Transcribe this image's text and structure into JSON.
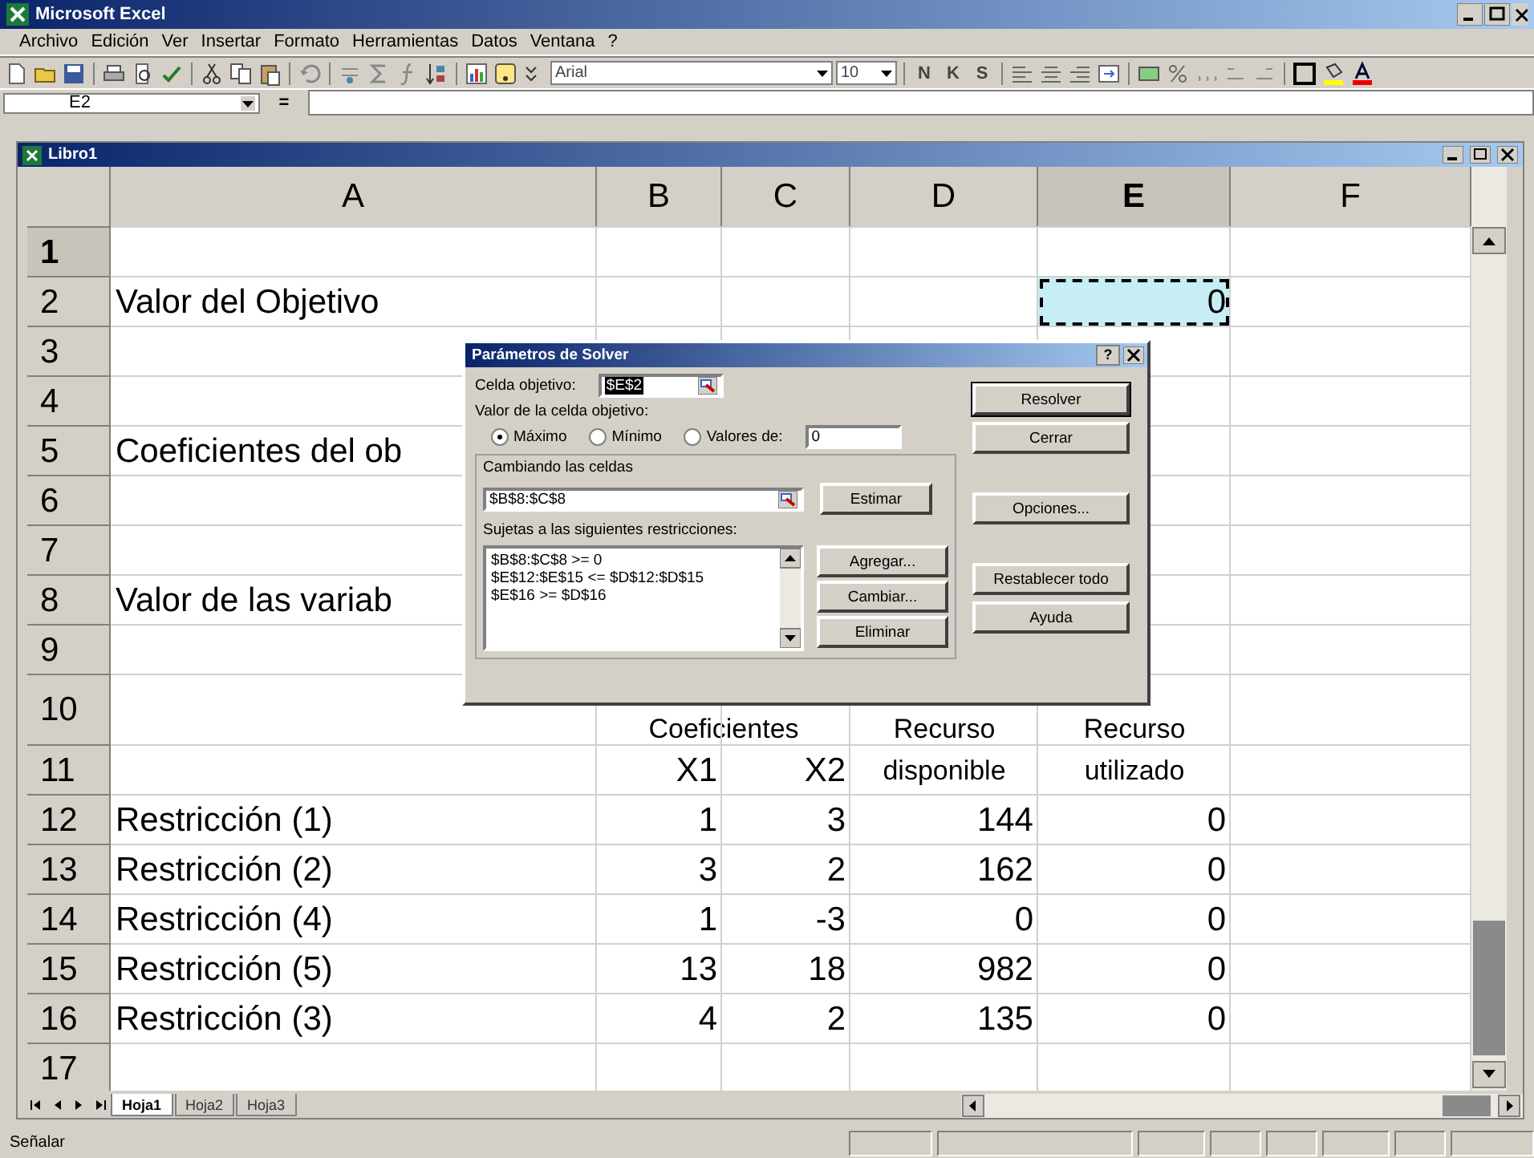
{
  "window": {
    "title": "Microsoft Excel"
  },
  "menu": [
    "Archivo",
    "Edición",
    "Ver",
    "Insertar",
    "Formato",
    "Herramientas",
    "Datos",
    "Ventana",
    "?"
  ],
  "toolbar": {
    "font": "Arial",
    "size": "10",
    "format_buttons": [
      "N",
      "K",
      "S"
    ]
  },
  "formula_bar": {
    "name_box": "E2",
    "equals": "="
  },
  "workbook": {
    "title": "Libro1",
    "columns": [
      {
        "label": "A",
        "selected": false
      },
      {
        "label": "B",
        "selected": false
      },
      {
        "label": "C",
        "selected": false
      },
      {
        "label": "D",
        "selected": false
      },
      {
        "label": "E",
        "selected": true
      },
      {
        "label": "F",
        "selected": false
      }
    ],
    "rows": [
      {
        "number": "1",
        "selected": true,
        "cells": [
          {
            "kind": "empty"
          },
          {
            "kind": "empty"
          },
          {
            "kind": "empty"
          },
          {
            "kind": "empty"
          },
          {
            "kind": "empty"
          },
          {
            "kind": "empty"
          }
        ]
      },
      {
        "number": "2",
        "selected": false,
        "cells": [
          {
            "kind": "text",
            "text": "Valor del Objetivo"
          },
          {
            "kind": "empty"
          },
          {
            "kind": "empty"
          },
          {
            "kind": "empty"
          },
          {
            "kind": "marquee",
            "text": "0"
          },
          {
            "kind": "empty"
          }
        ]
      },
      {
        "number": "3",
        "selected": false,
        "cells": [
          {
            "kind": "empty"
          },
          {
            "kind": "empty"
          },
          {
            "kind": "empty"
          },
          {
            "kind": "empty"
          },
          {
            "kind": "empty"
          },
          {
            "kind": "empty"
          }
        ]
      },
      {
        "number": "4",
        "selected": false,
        "cells": [
          {
            "kind": "empty"
          },
          {
            "kind": "empty"
          },
          {
            "kind": "empty"
          },
          {
            "kind": "empty"
          },
          {
            "kind": "empty"
          },
          {
            "kind": "empty"
          }
        ]
      },
      {
        "number": "5",
        "selected": false,
        "cells": [
          {
            "kind": "text",
            "text": "Coeficientes del ob"
          },
          {
            "kind": "empty"
          },
          {
            "kind": "empty"
          },
          {
            "kind": "empty"
          },
          {
            "kind": "empty"
          },
          {
            "kind": "empty"
          }
        ]
      },
      {
        "number": "6",
        "selected": false,
        "cells": [
          {
            "kind": "empty"
          },
          {
            "kind": "empty"
          },
          {
            "kind": "empty"
          },
          {
            "kind": "empty"
          },
          {
            "kind": "empty"
          },
          {
            "kind": "empty"
          }
        ]
      },
      {
        "number": "7",
        "selected": false,
        "cells": [
          {
            "kind": "empty"
          },
          {
            "kind": "empty"
          },
          {
            "kind": "empty"
          },
          {
            "kind": "empty"
          },
          {
            "kind": "empty"
          },
          {
            "kind": "empty"
          }
        ]
      },
      {
        "number": "8",
        "selected": false,
        "cells": [
          {
            "kind": "text",
            "text": "Valor de las variab"
          },
          {
            "kind": "empty"
          },
          {
            "kind": "empty"
          },
          {
            "kind": "empty"
          },
          {
            "kind": "empty"
          },
          {
            "kind": "empty"
          }
        ]
      },
      {
        "number": "9",
        "selected": false,
        "cells": [
          {
            "kind": "empty"
          },
          {
            "kind": "empty"
          },
          {
            "kind": "empty"
          },
          {
            "kind": "empty"
          },
          {
            "kind": "empty"
          },
          {
            "kind": "empty"
          }
        ]
      },
      {
        "number": "10",
        "selected": false,
        "cells": [
          {
            "kind": "empty"
          },
          {
            "kind": "caption-wide",
            "text": "Coeficientes"
          },
          {
            "kind": "caption",
            "text": "Recurso"
          },
          {
            "kind": "caption",
            "text": "Recurso"
          },
          {
            "kind": "empty"
          }
        ]
      },
      {
        "number": "11",
        "selected": false,
        "cells": [
          {
            "kind": "empty"
          },
          {
            "kind": "numeric",
            "text": "X1"
          },
          {
            "kind": "numeric",
            "text": "X2"
          },
          {
            "kind": "caption",
            "text": "disponible"
          },
          {
            "kind": "caption",
            "text": "utilizado"
          },
          {
            "kind": "empty"
          }
        ]
      },
      {
        "number": "12",
        "selected": false,
        "cells": [
          {
            "kind": "text",
            "text": "Restricción (1)"
          },
          {
            "kind": "numeric",
            "text": "1"
          },
          {
            "kind": "numeric",
            "text": "3"
          },
          {
            "kind": "numeric",
            "text": "144"
          },
          {
            "kind": "numeric",
            "text": "0"
          },
          {
            "kind": "empty"
          }
        ]
      },
      {
        "number": "13",
        "selected": false,
        "cells": [
          {
            "kind": "text",
            "text": "Restricción (2)"
          },
          {
            "kind": "numeric",
            "text": "3"
          },
          {
            "kind": "numeric",
            "text": "2"
          },
          {
            "kind": "numeric",
            "text": "162"
          },
          {
            "kind": "numeric",
            "text": "0"
          },
          {
            "kind": "empty"
          }
        ]
      },
      {
        "number": "14",
        "selected": false,
        "cells": [
          {
            "kind": "text",
            "text": "Restricción (4)"
          },
          {
            "kind": "numeric",
            "text": "1"
          },
          {
            "kind": "numeric",
            "text": "-3"
          },
          {
            "kind": "numeric",
            "text": "0"
          },
          {
            "kind": "numeric",
            "text": "0"
          },
          {
            "kind": "empty"
          }
        ]
      },
      {
        "number": "15",
        "selected": false,
        "cells": [
          {
            "kind": "text",
            "text": "Restricción (5)"
          },
          {
            "kind": "numeric",
            "text": "13"
          },
          {
            "kind": "numeric",
            "text": "18"
          },
          {
            "kind": "numeric",
            "text": "982"
          },
          {
            "kind": "numeric",
            "text": "0"
          },
          {
            "kind": "empty"
          }
        ]
      },
      {
        "number": "16",
        "selected": false,
        "cells": [
          {
            "kind": "text",
            "text": "Restricción (3)"
          },
          {
            "kind": "numeric",
            "text": "4"
          },
          {
            "kind": "numeric",
            "text": "2"
          },
          {
            "kind": "numeric",
            "text": "135"
          },
          {
            "kind": "numeric",
            "text": "0"
          },
          {
            "kind": "empty"
          }
        ]
      },
      {
        "number": "17",
        "selected": false,
        "cells": [
          {
            "kind": "empty"
          },
          {
            "kind": "empty"
          },
          {
            "kind": "empty"
          },
          {
            "kind": "empty"
          },
          {
            "kind": "empty"
          },
          {
            "kind": "empty"
          }
        ]
      }
    ],
    "sheet_tabs": [
      {
        "label": "Hoja1",
        "selected": true
      },
      {
        "label": "Hoja2",
        "selected": false
      },
      {
        "label": "Hoja3",
        "selected": false
      }
    ]
  },
  "solver": {
    "title": "Parámetros de Solver",
    "help": "?",
    "target_label": "Celda objetivo:",
    "target_value": "$E$2",
    "value_label": "Valor de la celda objetivo:",
    "options": [
      {
        "label": "Máximo",
        "selected": true
      },
      {
        "label": "Mínimo",
        "selected": false
      },
      {
        "label": "Valores de:",
        "selected": false
      }
    ],
    "value_input": "0",
    "changing_label": "Cambiando las celdas",
    "changing_value": "$B$8:$C$8",
    "guess_button": "Estimar",
    "constraints_label": "Sujetas a las siguientes restricciones:",
    "constraints": [
      "$B$8:$C$8 >= 0",
      "$E$12:$E$15 <= $D$12:$D$15",
      "$E$16 >= $D$16"
    ],
    "list_buttons": [
      "Agregar...",
      "Cambiar...",
      "Eliminar"
    ],
    "side_buttons": [
      {
        "label": "Resolver",
        "kind": "default"
      },
      {
        "label": "Cerrar",
        "kind": "normal"
      },
      {
        "label": "Opciones...",
        "kind": "spaced"
      },
      {
        "label": "Restablecer todo",
        "kind": "spaced"
      },
      {
        "label": "Ayuda",
        "kind": "normal"
      }
    ]
  },
  "status_bar": {
    "text": "Señalar"
  }
}
